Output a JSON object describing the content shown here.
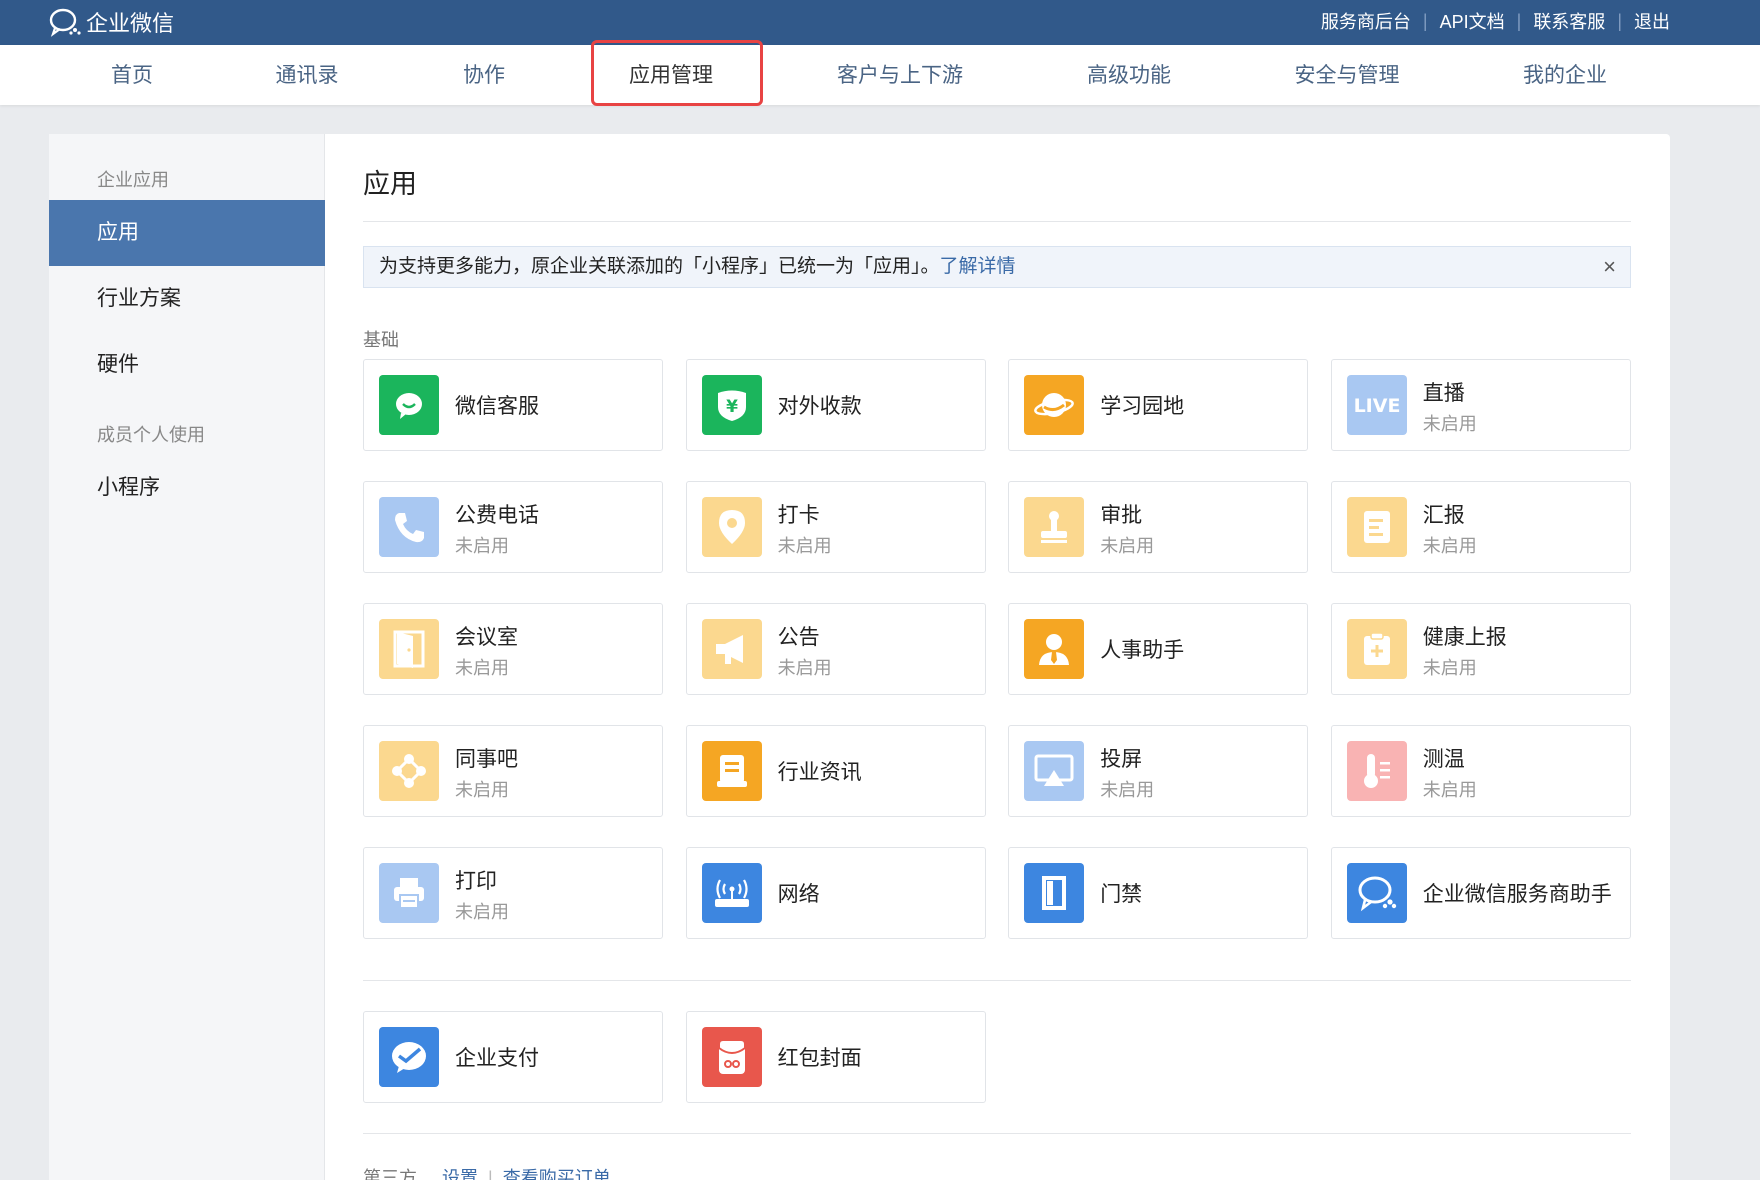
{
  "topbar": {
    "logo_text": "企业微信",
    "links": [
      "服务商后台",
      "API文档",
      "联系客服",
      "退出"
    ]
  },
  "nav": {
    "items": [
      "首页",
      "通讯录",
      "协作",
      "应用管理",
      "客户与上下游",
      "高级功能",
      "安全与管理",
      "我的企业"
    ],
    "active": "应用管理"
  },
  "sidebar": {
    "group1": "企业应用",
    "items1": [
      "应用",
      "行业方案",
      "硬件"
    ],
    "group2": "成员个人使用",
    "items2": [
      "小程序"
    ]
  },
  "main": {
    "title": "应用",
    "notice_text": "为支持更多能力，原企业关联添加的「小程序」已统一为「应用」。",
    "notice_link": "了解详情",
    "notice_close": "×",
    "section_basic": "基础",
    "apps": [
      {
        "name": "微信客服",
        "status": "",
        "icon": "wechat-service-icon",
        "color": "#1bb55c"
      },
      {
        "name": "对外收款",
        "status": "",
        "icon": "payment-shield-icon",
        "color": "#1bb55c"
      },
      {
        "name": "学习园地",
        "status": "",
        "icon": "planet-icon",
        "color": "#f5a623"
      },
      {
        "name": "直播",
        "status": "未启用",
        "icon": "live-icon",
        "color": "#a9c8f2"
      },
      {
        "name": "公费电话",
        "status": "未启用",
        "icon": "phone-icon",
        "color": "#a9c8f2"
      },
      {
        "name": "打卡",
        "status": "未启用",
        "icon": "location-pin-icon",
        "color": "#fbd88f"
      },
      {
        "name": "审批",
        "status": "未启用",
        "icon": "stamp-icon",
        "color": "#fbd88f"
      },
      {
        "name": "汇报",
        "status": "未启用",
        "icon": "report-doc-icon",
        "color": "#fbd88f"
      },
      {
        "name": "会议室",
        "status": "未启用",
        "icon": "door-icon",
        "color": "#fbd88f"
      },
      {
        "name": "公告",
        "status": "未启用",
        "icon": "megaphone-icon",
        "color": "#fbd88f"
      },
      {
        "name": "人事助手",
        "status": "",
        "icon": "person-tie-icon",
        "color": "#f5a623"
      },
      {
        "name": "健康上报",
        "status": "未启用",
        "icon": "health-clipboard-icon",
        "color": "#fbd88f"
      },
      {
        "name": "同事吧",
        "status": "未启用",
        "icon": "network-dots-icon",
        "color": "#fbd88f"
      },
      {
        "name": "行业资讯",
        "status": "",
        "icon": "news-doc-icon",
        "color": "#f5a623"
      },
      {
        "name": "投屏",
        "status": "未启用",
        "icon": "screen-cast-icon",
        "color": "#a9c8f2"
      },
      {
        "name": "测温",
        "status": "未启用",
        "icon": "thermometer-icon",
        "color": "#f9b3b3"
      },
      {
        "name": "打印",
        "status": "未启用",
        "icon": "printer-icon",
        "color": "#a9c8f2"
      },
      {
        "name": "网络",
        "status": "",
        "icon": "router-icon",
        "color": "#3d86e0"
      },
      {
        "name": "门禁",
        "status": "",
        "icon": "door-access-icon",
        "color": "#3d86e0"
      },
      {
        "name": "企业微信服务商助手",
        "status": "",
        "icon": "chat-bubble-icon",
        "color": "#3d86e0"
      }
    ],
    "apps2": [
      {
        "name": "企业支付",
        "status": "",
        "icon": "pay-check-icon",
        "color": "#3d86e0"
      },
      {
        "name": "红包封面",
        "status": "",
        "icon": "red-envelope-icon",
        "color": "#e8574c"
      }
    ],
    "third_party_label": "第三方",
    "third_links": [
      "设置",
      "查看购买订单"
    ]
  }
}
